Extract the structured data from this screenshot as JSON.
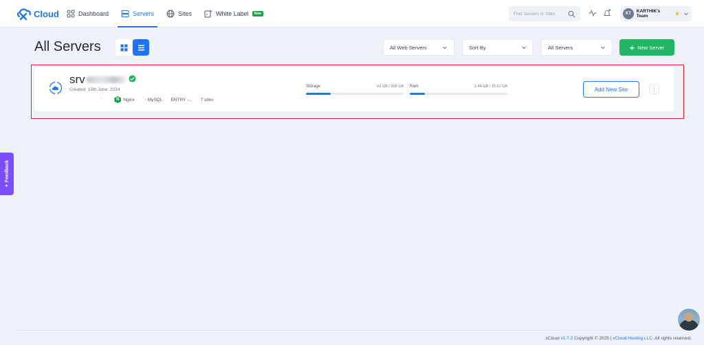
{
  "brand": {
    "name": "Cloud",
    "accent": "#1d74f5"
  },
  "nav": {
    "items": [
      {
        "label": "Dashboard",
        "icon": "dashboard-icon"
      },
      {
        "label": "Servers",
        "icon": "servers-icon",
        "active": true
      },
      {
        "label": "Sites",
        "icon": "globe-icon"
      },
      {
        "label": "White Label",
        "icon": "white-label-icon",
        "badge": "New"
      }
    ]
  },
  "search": {
    "placeholder": "Find Servers or Sites"
  },
  "team": {
    "initials": "KT",
    "name": "KARTHIK's Team"
  },
  "page": {
    "title": "All Servers",
    "filters": [
      "All Web Servers",
      "Sort By",
      "All Servers"
    ],
    "new_server_label": "New Server"
  },
  "server": {
    "name_prefix": "srv",
    "created": "Created: 15th June, 2024",
    "tick": "'",
    "web_server": "Nginx",
    "database": "MySQL",
    "plan": "ENTRY -...",
    "sites": "7 sites",
    "storage": {
      "label": "Storage",
      "value": "53 GB / 208 GB",
      "fraction": 0.255
    },
    "ram": {
      "label": "Ram",
      "value": "2.44 GB / 15.61 GB",
      "fraction": 0.156
    },
    "add_site_label": "Add New Site",
    "status_color": "#22b566"
  },
  "feedback": {
    "label": "Feedback"
  },
  "footer": {
    "brand": "xCloud",
    "version": "v1.7.2",
    "copyright": "Copyright © 2025 |",
    "company": "xCloud Hosting LLC.",
    "rights": "All rights reserved."
  }
}
